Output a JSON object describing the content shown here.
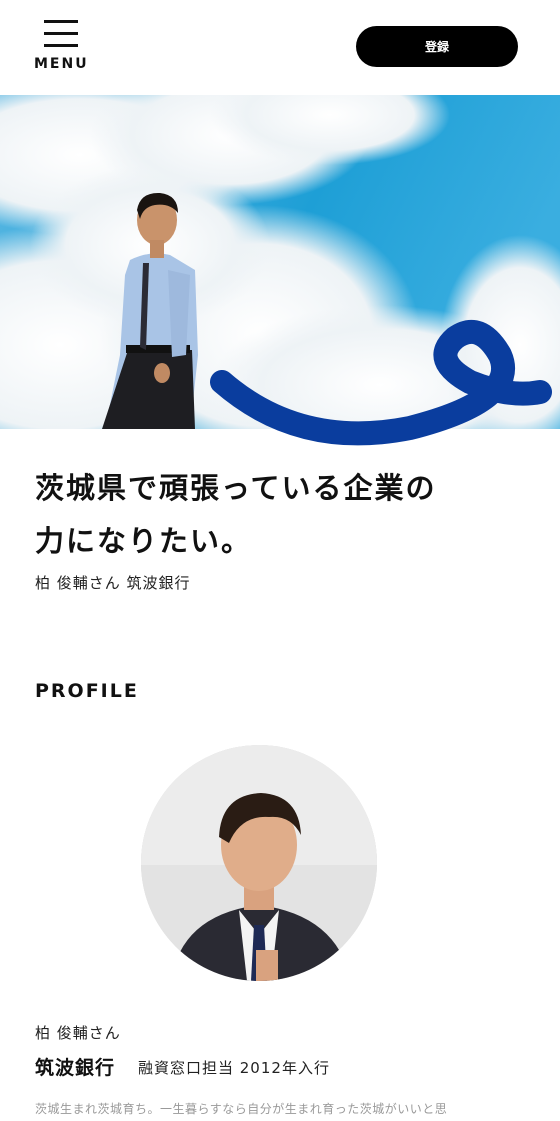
{
  "header": {
    "menu_label": "MENU",
    "register_label": "登録"
  },
  "hero": {
    "image_description": "man in shirt and tie under blue sky with clouds",
    "accent_color": "#0a3d9e",
    "sky_color": "#1e9fd6"
  },
  "article": {
    "headline_line1": "茨城県で頑張っている企業の",
    "headline_line2": "力になりたい。",
    "byline": "柏 俊輔さん 筑波銀行"
  },
  "profile": {
    "section_title": "PROFILE",
    "name": "柏 俊輔さん",
    "company": "筑波銀行",
    "role": "融資窓口担当 2012年入行",
    "description": "茨城生まれ茨城育ち。一生暮らすなら自分が生まれ育った茨城がいいと思"
  }
}
